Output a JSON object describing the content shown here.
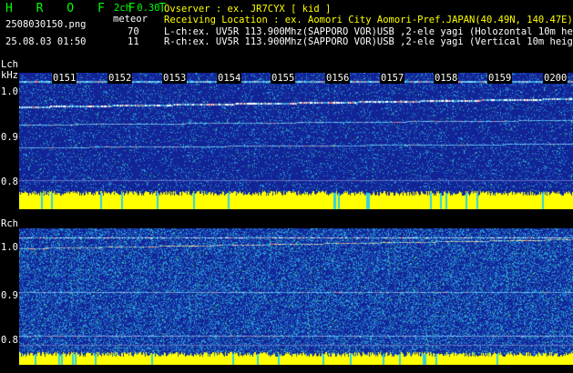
{
  "app_title": "H R O F F T",
  "mode": "2ch 0.30",
  "mode_sub": "meteor",
  "filename": "2508030150.png",
  "datetime": "25.08.03 01:50",
  "counts": {
    "lch": "70",
    "rch": "11"
  },
  "info": {
    "observer": "Ovserver             : ex. JR7CYX [ kid ]",
    "location": "Receiving Location : ex. Aomori City Aomori-Pref.JAPAN(40.49N, 140.47E)",
    "lch": "L-ch:ex. UV5R 113.900Mhz(SAPPORO VOR)USB ,2-ele yagi (Holozontal 10m height)",
    "rch": "R-ch:ex. UV5R 113.900Mhz(SAPPORO VOR)USB ,2-ele yagi (Vertical 10m height)"
  },
  "lch": {
    "label": "Lch",
    "unit": "kHz"
  },
  "rch": {
    "label": "Rch"
  },
  "yticks": [
    "1.0",
    "0.9",
    "0.8"
  ],
  "time_labels": [
    "0151",
    "0152",
    "0153",
    "0154",
    "0155",
    "0156",
    "0157",
    "0158",
    "0159",
    "0200"
  ],
  "colors": {
    "background": "#000000",
    "text_green": "#00ff00",
    "spectrum_blue": "#1a2fa0",
    "signal_yellow": "#ffff00"
  }
}
